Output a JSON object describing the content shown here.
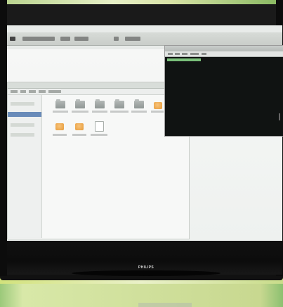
{
  "photo": {
    "brand": "PHILIPS"
  },
  "desktop": {
    "top_panel": {
      "menus": [
        "",
        "",
        "",
        "",
        ""
      ]
    }
  }
}
